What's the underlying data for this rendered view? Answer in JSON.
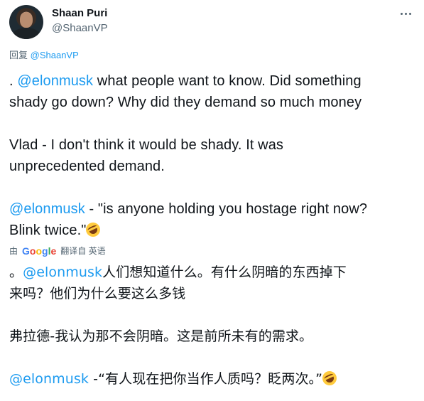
{
  "author": {
    "name": "Shaan Puri",
    "handle": "@ShaanVP"
  },
  "more_icon": "more-horizontal-icon",
  "reply": {
    "prefix": "回复",
    "handle": "@ShaanVP"
  },
  "original": {
    "p1_lead": ". ",
    "p1_mention": "@elonmusk",
    "p1_line1_rest": " what people want to know. Did something",
    "p1_line2": "shady go down? Why did they demand so much money",
    "p2_line1": "Vlad - I don't think it would be shady. It was",
    "p2_line2": "unprecedented demand.",
    "p3_mention": "@elonmusk",
    "p3_line1_rest": " - \"is anyone holding you hostage right now?",
    "p3_line2": "Blink twice.\"",
    "emoji": "rolling-on-floor-laughing-emoji"
  },
  "translation_bar": {
    "by": "由",
    "google": "Google",
    "label": "翻译自 英语"
  },
  "translated": {
    "p1_lead": "。",
    "p1_mention": "@elonmusk",
    "p1_line1_rest": "人们想知道什么。有什么阴暗的东西掉下",
    "p1_line2": "来吗？他们为什么要这么多钱",
    "p2_line1": "弗拉德-我认为那不会阴暗。这是前所未有的需求。",
    "p3_mention": "@elonmusk",
    "p3_line1_rest": " -“有人现在把你当作人质吗？眨两次。”",
    "emoji": "rolling-on-floor-laughing-emoji"
  },
  "colors": {
    "text": "#0f1419",
    "secondary": "#536471",
    "link": "#1d9bf0"
  }
}
